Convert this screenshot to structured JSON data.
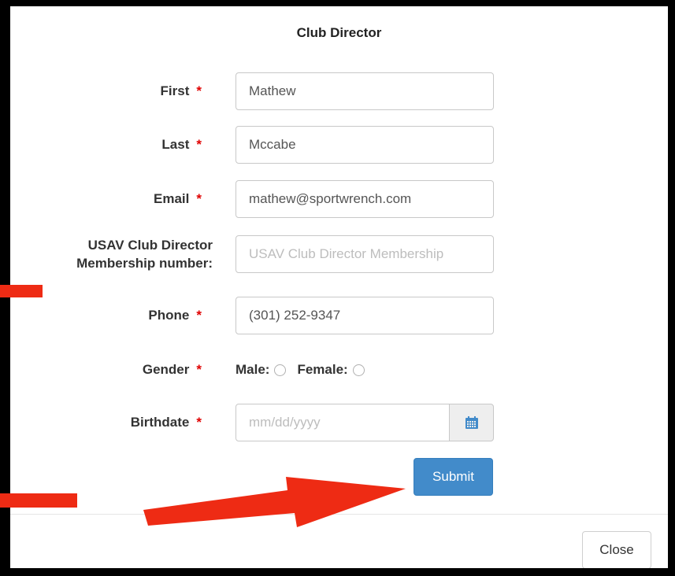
{
  "modal": {
    "title": "Club Director"
  },
  "form": {
    "first": {
      "label": "First",
      "required": "*",
      "value": "Mathew"
    },
    "last": {
      "label": "Last",
      "required": "*",
      "value": "Mccabe"
    },
    "email": {
      "label": "Email",
      "required": "*",
      "value": "mathew@sportwrench.com"
    },
    "usav": {
      "label_line1": "USAV Club Director",
      "label_line2": "Membership number:",
      "placeholder": "USAV Club Director Membership"
    },
    "phone": {
      "label": "Phone",
      "required": "*",
      "value": "(301) 252-9347"
    },
    "gender": {
      "label": "Gender",
      "required": "*",
      "male": "Male:",
      "female": "Female:"
    },
    "birthdate": {
      "label": "Birthdate",
      "required": "*",
      "placeholder": "mm/dd/yyyy",
      "icon": "calendar-icon"
    }
  },
  "buttons": {
    "submit": "Submit",
    "close": "Close"
  },
  "colors": {
    "primary": "#428bca",
    "required": "#e00000",
    "annotation_arrow": "#ee2b14"
  }
}
